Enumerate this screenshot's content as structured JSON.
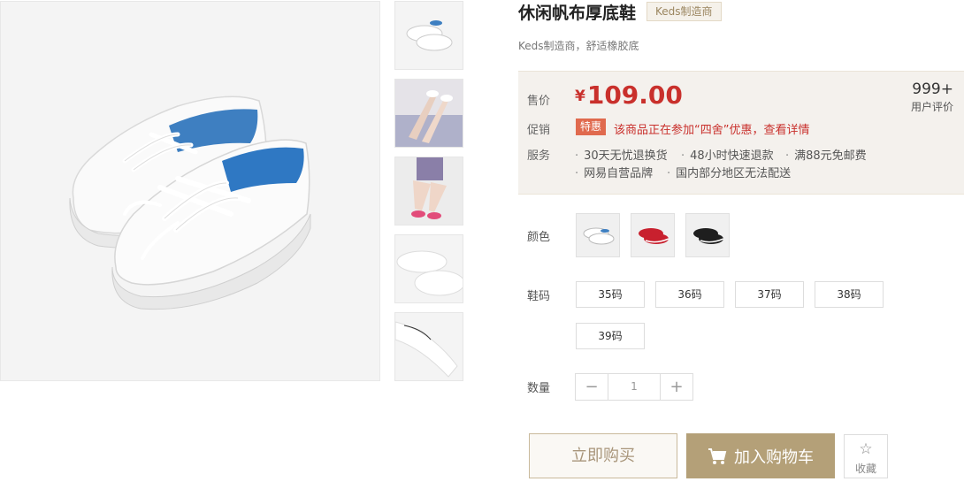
{
  "product": {
    "title": "休闲帆布厚底鞋",
    "brand_tag": "Keds制造商",
    "subtitle": "Keds制造商，舒适橡胶底"
  },
  "price_box": {
    "price_label": "售价",
    "currency": "¥",
    "price": "109.00",
    "promo_label": "促销",
    "promo_tag": "特惠",
    "promo_text": "该商品正在参加“四舍”优惠，查看详情",
    "service_label": "服务",
    "services": [
      "30天无忧退换货",
      "48小时快速退款",
      "满88元免邮费",
      "网易自营品牌",
      "国内部分地区无法配送"
    ],
    "review_count": "999+",
    "review_label": "用户评价"
  },
  "options": {
    "color_label": "颜色",
    "colors": [
      {
        "name": "white",
        "hex": "#f2f2f2"
      },
      {
        "name": "red",
        "hex": "#c8202e"
      },
      {
        "name": "black",
        "hex": "#1e1e1e"
      }
    ],
    "size_label": "鞋码",
    "sizes": [
      "35码",
      "36码",
      "37码",
      "38码",
      "39码"
    ],
    "quantity_label": "数量",
    "quantity": "1",
    "minus": "−",
    "plus": "+"
  },
  "actions": {
    "buy_now": "立即购买",
    "add_to_cart": "加入购物车",
    "favorite": "收藏"
  },
  "icons": {
    "cart": "cart-icon",
    "favorite": "star-icon"
  }
}
